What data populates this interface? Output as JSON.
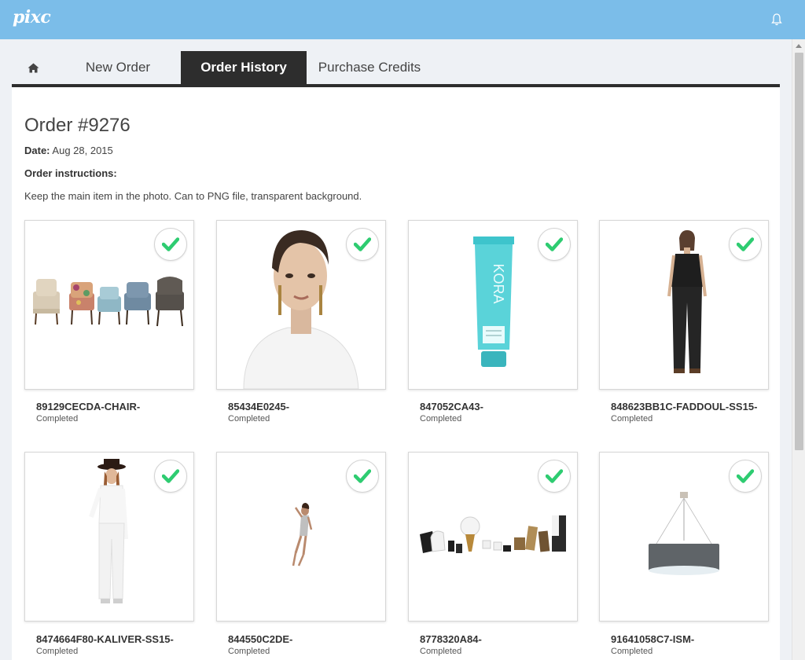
{
  "app": {
    "logo": "pixc"
  },
  "icons": {
    "bell": "bell-icon",
    "home": "home-icon",
    "check": "check-icon"
  },
  "colors": {
    "topbar": "#7bbde9",
    "tab_active": "#2d2d2d",
    "check": "#2ecc71"
  },
  "tabs": [
    {
      "label": "",
      "icon": "home-icon"
    },
    {
      "label": "New Order"
    },
    {
      "label": "Order History",
      "active": true
    },
    {
      "label": "Purchase Credits"
    }
  ],
  "order": {
    "title": "Order #9276",
    "date_label": "Date:",
    "date_value": "Aug 28, 2015",
    "instructions_label": "Order instructions:",
    "instructions": "Keep the main item in the photo. Can to PNG file, transparent background."
  },
  "items": [
    {
      "name": "89129CECDA-CHAIR-",
      "status": "Completed",
      "image": "armchairs"
    },
    {
      "name": "85434E0245-",
      "status": "Completed",
      "image": "woman-portrait"
    },
    {
      "name": "847052CA43-",
      "status": "Completed",
      "image": "kora-tube"
    },
    {
      "name": "848623BB1C-FADDOUL-SS15-",
      "status": "Completed",
      "image": "black-outfit"
    },
    {
      "name": "8474664F80-KALIVER-SS15-",
      "status": "Completed",
      "image": "white-outfit"
    },
    {
      "name": "844550C2DE-",
      "status": "Completed",
      "image": "swimsuit-model"
    },
    {
      "name": "8778320A84-",
      "status": "Completed",
      "image": "ceramics"
    },
    {
      "name": "91641058C7-ISM-",
      "status": "Completed",
      "image": "pendant-lamp"
    }
  ]
}
